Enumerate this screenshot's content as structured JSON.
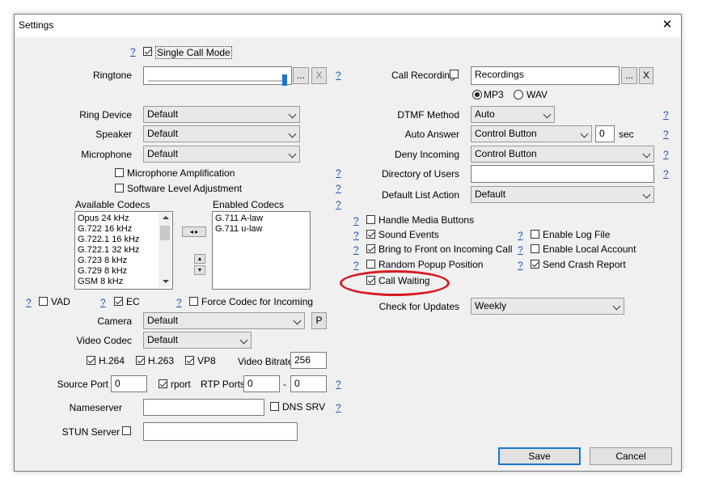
{
  "window": {
    "title": "Settings",
    "close_glyph": "✕"
  },
  "help_glyph": "?",
  "left": {
    "single_call_mode": {
      "label": "Single Call Mode",
      "checked": true
    },
    "ringtone": {
      "label": "Ringtone",
      "value": "",
      "browse": "...",
      "clear": "X"
    },
    "ring_device": {
      "label": "Ring Device",
      "value": "Default"
    },
    "speaker": {
      "label": "Speaker",
      "value": "Default"
    },
    "microphone": {
      "label": "Microphone",
      "value": "Default"
    },
    "mic_amplification": {
      "label": "Microphone Amplification",
      "checked": false
    },
    "software_level": {
      "label": "Software Level Adjustment",
      "checked": false
    },
    "available_codecs": {
      "label": "Available Codecs",
      "items": [
        "Opus 24 kHz",
        "G.722 16 kHz",
        "G.722.1 16 kHz",
        "G.722.1 32 kHz",
        "G.723 8 kHz",
        "G.729 8 kHz",
        "GSM 8 kHz"
      ]
    },
    "enabled_codecs": {
      "label": "Enabled Codecs",
      "items": [
        "G.711 A-law",
        "G.711 u-law"
      ]
    },
    "vad": {
      "label": "VAD",
      "checked": false
    },
    "ec": {
      "label": "EC",
      "checked": true
    },
    "force_codec": {
      "label": "Force Codec for Incoming",
      "checked": false
    },
    "camera": {
      "label": "Camera",
      "value": "Default",
      "button": "P"
    },
    "video_codec": {
      "label": "Video Codec",
      "value": "Default"
    },
    "h264": {
      "label": "H.264",
      "checked": true
    },
    "h263": {
      "label": "H.263",
      "checked": true
    },
    "vp8": {
      "label": "VP8",
      "checked": true
    },
    "video_bitrate": {
      "label": "Video Bitrate",
      "value": "256"
    },
    "source_port": {
      "label": "Source Port",
      "value": "0"
    },
    "rport": {
      "label": "rport",
      "checked": true
    },
    "rtp_ports": {
      "label": "RTP Ports",
      "from": "0",
      "dash": "-",
      "to": "0"
    },
    "nameserver": {
      "label": "Nameserver",
      "value": ""
    },
    "dns_srv": {
      "label": "DNS SRV",
      "checked": false
    },
    "stun_server": {
      "label": "STUN Server",
      "checked": false,
      "value": ""
    }
  },
  "right": {
    "call_recording": {
      "label": "Call Recording",
      "checked": false,
      "value": "Recordings",
      "browse": "...",
      "clear": "X"
    },
    "mp3": {
      "label": "MP3",
      "selected": true
    },
    "wav": {
      "label": "WAV",
      "selected": false
    },
    "dtmf_method": {
      "label": "DTMF Method",
      "value": "Auto"
    },
    "auto_answer": {
      "label": "Auto Answer",
      "value": "Control Button",
      "seconds": "0",
      "unit": "sec"
    },
    "deny_incoming": {
      "label": "Deny Incoming",
      "value": "Control Button"
    },
    "directory_of_users": {
      "label": "Directory of Users",
      "value": ""
    },
    "default_list_action": {
      "label": "Default List Action",
      "value": "Default"
    },
    "handle_media_buttons": {
      "label": "Handle Media Buttons",
      "checked": false
    },
    "sound_events": {
      "label": "Sound Events",
      "checked": true
    },
    "bring_to_front": {
      "label": "Bring to Front on Incoming Call",
      "checked": true
    },
    "random_popup": {
      "label": "Random Popup Position",
      "checked": false
    },
    "call_waiting": {
      "label": "Call Waiting",
      "checked": true
    },
    "enable_log_file": {
      "label": "Enable Log File",
      "checked": false
    },
    "enable_local_account": {
      "label": "Enable Local Account",
      "checked": false
    },
    "send_crash_report": {
      "label": "Send Crash Report",
      "checked": true
    },
    "check_for_updates": {
      "label": "Check for Updates",
      "value": "Weekly"
    }
  },
  "buttons": {
    "save": "Save",
    "cancel": "Cancel"
  },
  "colors": {
    "help_link": "#1a54b8",
    "highlight_ellipse": "#d8181f",
    "slider_thumb": "#1a76d2"
  }
}
